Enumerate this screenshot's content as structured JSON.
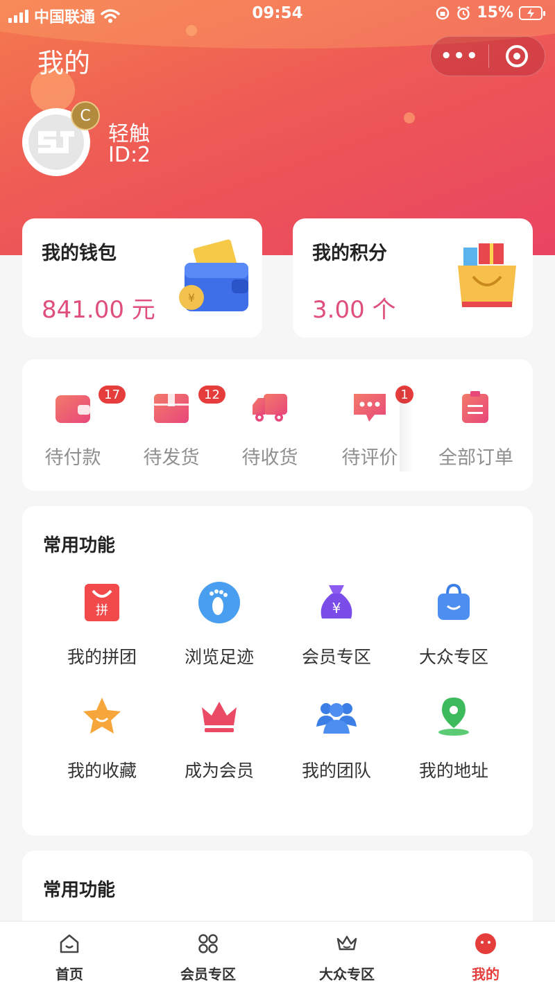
{
  "status_bar": {
    "carrier": "中国联通",
    "time": "09:54",
    "battery": "15%"
  },
  "header": {
    "title": "我的",
    "capsule_more": "•••"
  },
  "user": {
    "name": "轻触",
    "id": "ID:2",
    "badge": "C"
  },
  "wallet": {
    "title": "我的钱包",
    "value": "841.00 元"
  },
  "points": {
    "title": "我的积分",
    "value": "3.00 个"
  },
  "orders": [
    {
      "label": "待付款",
      "count": "17",
      "icon": "wallet-icon"
    },
    {
      "label": "待发货",
      "count": "12",
      "icon": "box-icon"
    },
    {
      "label": "待收货",
      "count": "",
      "icon": "truck-icon"
    },
    {
      "label": "待评价",
      "count": "1",
      "icon": "comment-icon"
    },
    {
      "label": "全部订单",
      "count": "",
      "icon": "clipboard-icon"
    }
  ],
  "functions": {
    "title": "常用功能",
    "items": [
      {
        "label": "我的拼团",
        "icon": "group-buy-icon"
      },
      {
        "label": "浏览足迹",
        "icon": "footprint-icon"
      },
      {
        "label": "会员专区",
        "icon": "money-bag-icon"
      },
      {
        "label": "大众专区",
        "icon": "shopping-bag-icon"
      },
      {
        "label": "我的收藏",
        "icon": "star-icon"
      },
      {
        "label": "成为会员",
        "icon": "crown-icon"
      },
      {
        "label": "我的团队",
        "icon": "team-icon"
      },
      {
        "label": "我的地址",
        "icon": "location-icon"
      }
    ]
  },
  "functions_2": {
    "title": "常用功能"
  },
  "tabbar": {
    "tabs": [
      {
        "label": "首页",
        "icon": "home-icon"
      },
      {
        "label": "会员专区",
        "icon": "grid-icon"
      },
      {
        "label": "大众专区",
        "icon": "crown-outline-icon"
      },
      {
        "label": "我的",
        "icon": "profile-icon"
      }
    ],
    "active_color": "#e53c3c"
  },
  "colors": {
    "accent": "#e04f7c",
    "header_start": "#f47a4e",
    "header_end": "#e94462"
  }
}
